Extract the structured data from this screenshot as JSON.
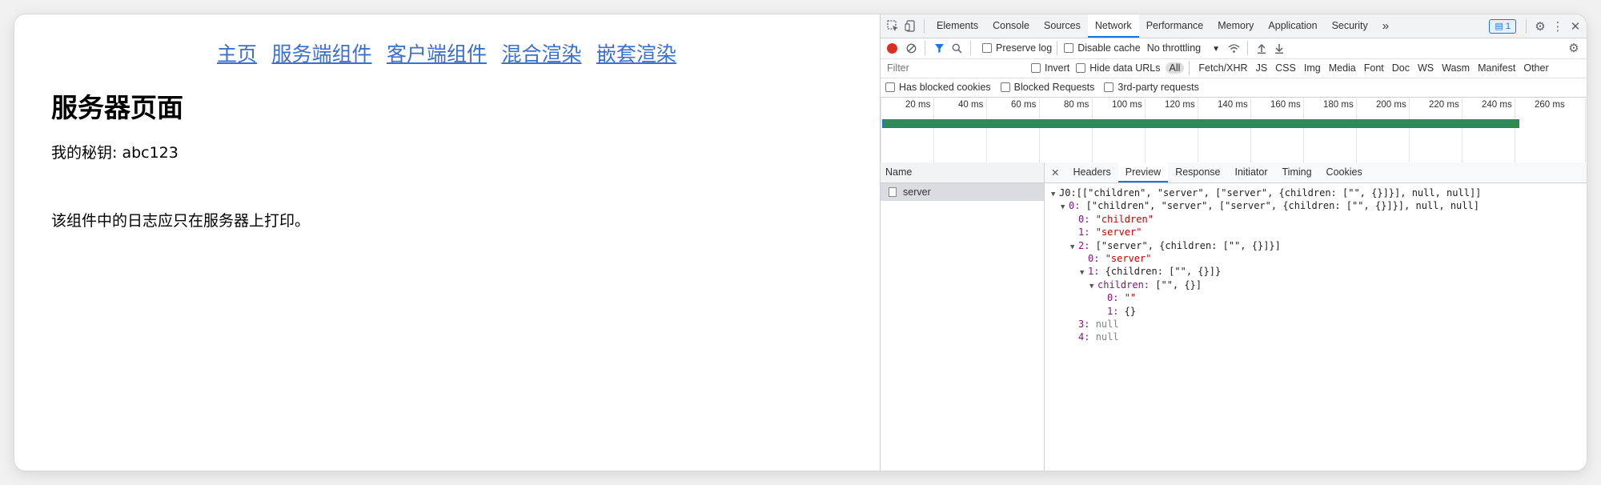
{
  "page": {
    "nav": [
      "主页",
      "服务端组件",
      "客户端组件",
      "混合渲染",
      "嵌套渲染"
    ],
    "heading": "服务器页面",
    "secret": "我的秘钥: abc123",
    "note": "该组件中的日志应只在服务器上打印。"
  },
  "devtools": {
    "tabs": [
      "Elements",
      "Console",
      "Sources",
      "Network",
      "Performance",
      "Memory",
      "Application",
      "Security"
    ],
    "active_tab": "Network",
    "more_tabs": "»",
    "issues_badge": "1",
    "toolbar": {
      "preserve_log": "Preserve log",
      "disable_cache": "Disable cache",
      "throttling": "No throttling"
    },
    "filter": {
      "placeholder": "Filter",
      "invert": "Invert",
      "hide_data_urls": "Hide data URLs",
      "types": [
        "All",
        "Fetch/XHR",
        "JS",
        "CSS",
        "Img",
        "Media",
        "Font",
        "Doc",
        "WS",
        "Wasm",
        "Manifest",
        "Other"
      ],
      "active_type": "All",
      "has_blocked_cookies": "Has blocked cookies",
      "blocked_requests": "Blocked Requests",
      "third_party": "3rd-party requests"
    },
    "timeline_ticks": [
      "20 ms",
      "40 ms",
      "60 ms",
      "80 ms",
      "100 ms",
      "120 ms",
      "140 ms",
      "160 ms",
      "180 ms",
      "200 ms",
      "220 ms",
      "240 ms",
      "260 ms"
    ],
    "name_header": "Name",
    "requests": [
      "server"
    ],
    "detail_tabs": [
      "Headers",
      "Preview",
      "Response",
      "Initiator",
      "Timing",
      "Cookies"
    ],
    "active_detail_tab": "Preview",
    "preview": {
      "l1": "J0:[[\"children\", \"server\", [\"server\", {children: [\"\", {}]}], null, null]]",
      "l2_key": "0:",
      "l2_val": " [\"children\", \"server\", [\"server\", {children: [\"\", {}]}], null, null]",
      "l3_key": "0:",
      "l3_val": "\"children\"",
      "l4_key": "1:",
      "l4_val": "\"server\"",
      "l5_key": "2:",
      "l5_val": " [\"server\", {children: [\"\", {}]}]",
      "l6_key": "0:",
      "l6_val": "\"server\"",
      "l7_key": "1:",
      "l7_val": " {children: [\"\", {}]}",
      "l8_key": "children:",
      "l8_val": " [\"\", {}]",
      "l9_key": "0:",
      "l9_val": "\"\"",
      "l10_key": "1:",
      "l10_val": " {}",
      "l11_key": "3:",
      "l11_val": "null",
      "l12_key": "4:",
      "l12_val": "null"
    }
  }
}
